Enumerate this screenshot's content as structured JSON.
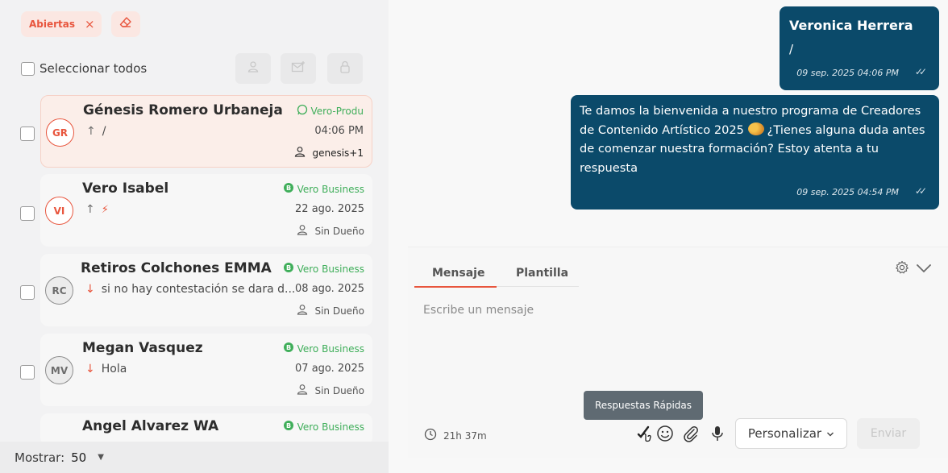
{
  "filters": {
    "chip_label": "Abiertas",
    "chip_close_icon": "close-icon",
    "clear_icon": "eraser-icon"
  },
  "select_all": {
    "label": "Seleccionar todos",
    "toolbar_icons": [
      "assign-user-icon",
      "mail-icon",
      "lock-icon"
    ]
  },
  "conversations": [
    {
      "initials": "GR",
      "name": "Génesis Romero Urbaneja",
      "channel": "Vero-Produ",
      "channel_icon": "whatsapp-icon",
      "direction": "up",
      "preview": "/",
      "time": "04:06 PM",
      "owner": "genesis+1",
      "active": true
    },
    {
      "initials": "VI",
      "name": "Vero Isabel",
      "channel": "Vero Business",
      "channel_icon": "whatsapp-business-icon",
      "direction": "up",
      "preview": "⚡",
      "time": "22 ago. 2025",
      "owner": "Sin Dueño",
      "active": false
    },
    {
      "initials": "RC",
      "name": "Retiros Colchones EMMA",
      "channel": "Vero Business",
      "channel_icon": "whatsapp-business-icon",
      "direction": "down",
      "preview": "si no hay contestación se dara d...",
      "time": "08 ago. 2025",
      "owner": "Sin Dueño",
      "active": false
    },
    {
      "initials": "MV",
      "name": "Megan Vasquez",
      "channel": "Vero Business",
      "channel_icon": "whatsapp-business-icon",
      "direction": "down",
      "preview": "Hola",
      "time": "07 ago. 2025",
      "owner": "Sin Dueño",
      "active": false
    },
    {
      "initials": "",
      "name": "Angel Alvarez WA",
      "channel": "Vero Business",
      "channel_icon": "whatsapp-business-icon",
      "direction": "",
      "preview": "",
      "time": "",
      "owner": "",
      "active": false
    }
  ],
  "pagination": {
    "label": "Mostrar:",
    "value": "50"
  },
  "messages": [
    {
      "sender": "Veronica Herrera",
      "text": "/",
      "time": "09 sep. 2025 04:06 PM",
      "status_icon": "double-check-icon"
    },
    {
      "text_before": "Te damos la bienvenida a nuestro programa de Creadores de Contenido Artístico 2025",
      "emoji": "palette-emoji",
      "text_after": "¿Tienes alguna duda antes de comenzar nuestra formación? Estoy atenta a tu respuesta",
      "time": "09 sep. 2025 04:54 PM",
      "status_icon": "double-check-icon"
    }
  ],
  "composer": {
    "tabs": [
      "Mensaje",
      "Plantilla"
    ],
    "active_tab": "Mensaje",
    "placeholder": "Escribe un mensaje",
    "timer": "21h 37m",
    "tooltip": "Respuestas Rápidas",
    "personalizar_label": "Personalizar",
    "send_label": "Enviar",
    "tool_icons": [
      "quick-replies-icon",
      "emoji-icon",
      "attach-icon",
      "microphone-icon"
    ]
  },
  "colors": {
    "accent": "#e8553d",
    "bubble": "#0b4a6a",
    "whatsapp": "#3fae5a"
  }
}
